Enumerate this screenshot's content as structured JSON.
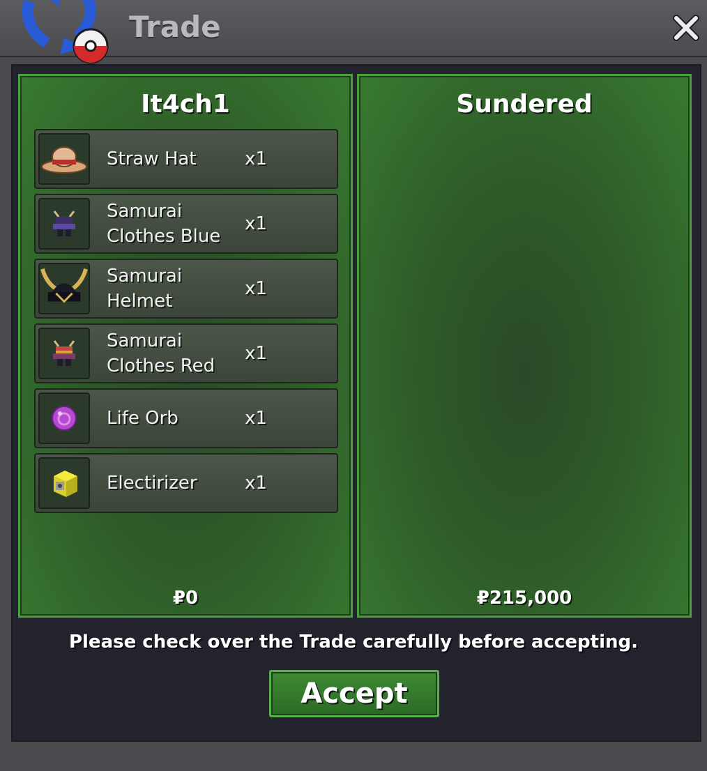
{
  "window": {
    "title": "Trade",
    "logo_icon": "pokeball-swap-icon",
    "close_icon": "close-icon"
  },
  "left_player": {
    "name": "It4ch1",
    "money": "₽0",
    "items": [
      {
        "name": "Straw Hat",
        "qty": "x1",
        "icon": "straw-hat-icon"
      },
      {
        "name": "Samurai Clothes Blue",
        "qty": "x1",
        "icon": "samurai-clothes-blue-icon"
      },
      {
        "name": "Samurai Helmet",
        "qty": "x1",
        "icon": "samurai-helmet-icon"
      },
      {
        "name": "Samurai Clothes Red",
        "qty": "x1",
        "icon": "samurai-clothes-red-icon"
      },
      {
        "name": "Life Orb",
        "qty": "x1",
        "icon": "life-orb-icon"
      },
      {
        "name": "Electirizer",
        "qty": "x1",
        "icon": "electirizer-icon"
      }
    ]
  },
  "right_player": {
    "name": "Sundered",
    "money": "₽215,000",
    "items": []
  },
  "notice": "Please check over the Trade carefully before accepting.",
  "accept_label": "Accept",
  "colors": {
    "panel_green": "#2e5a28",
    "panel_border": "#47a03a",
    "button_green": "#3d8a33",
    "background_dark": "#23232e"
  }
}
